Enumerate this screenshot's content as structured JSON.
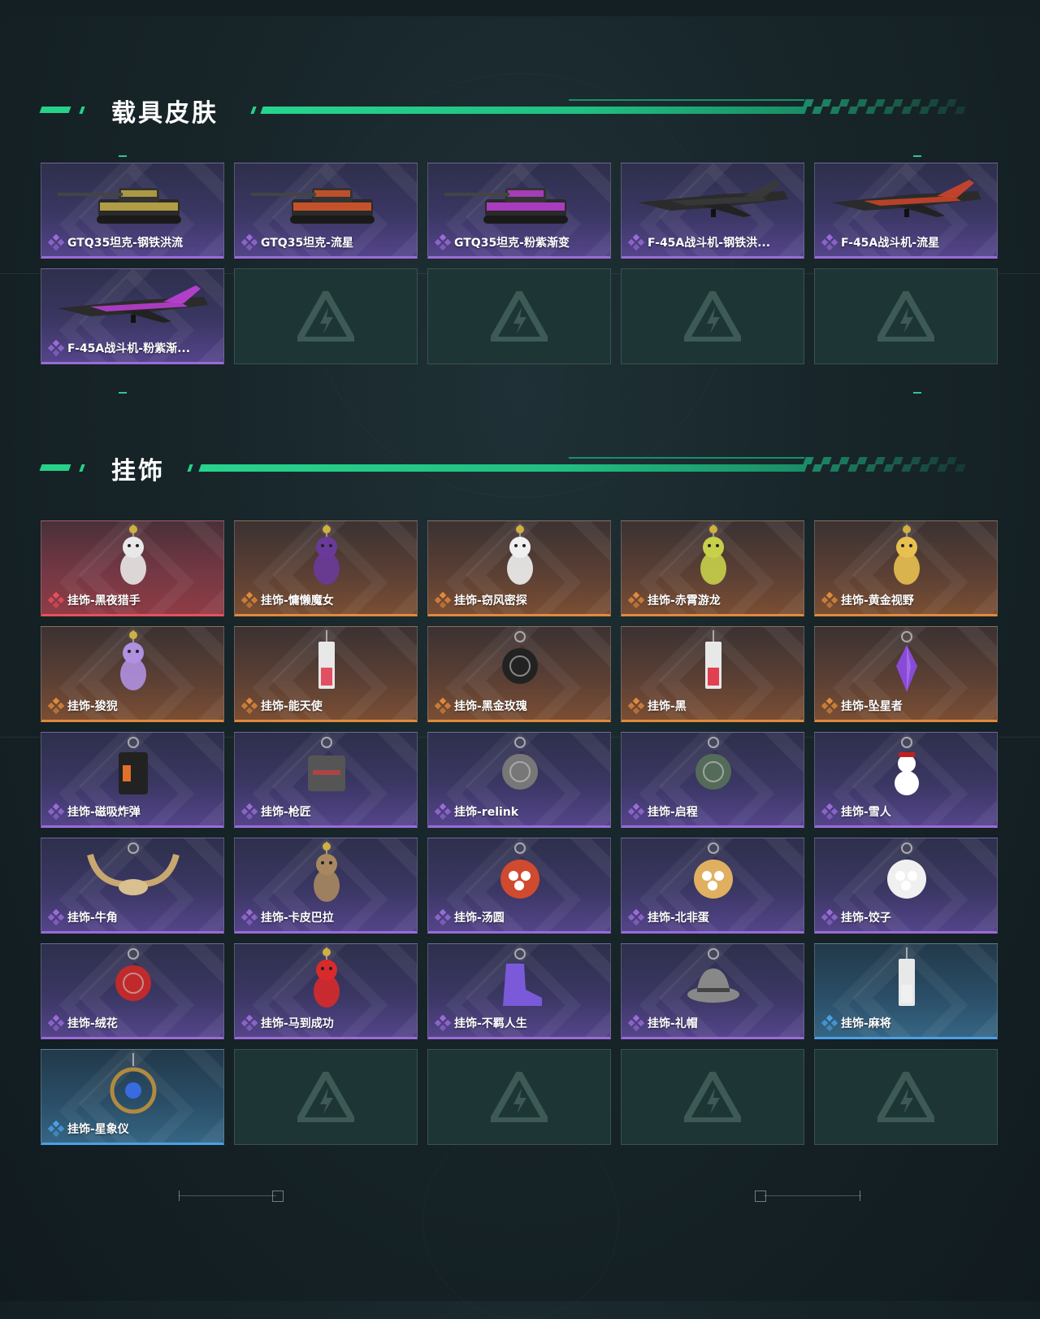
{
  "sections": {
    "vehicles": {
      "title": "载具皮肤",
      "items": [
        {
          "label": "GTQ35坦克-钢铁洪流",
          "rarity": "purple",
          "art": "tank",
          "color": "#c9b24a"
        },
        {
          "label": "GTQ35坦克-流星",
          "rarity": "purple",
          "art": "tank",
          "color": "#e0582a"
        },
        {
          "label": "GTQ35坦克-粉紫渐变",
          "rarity": "purple",
          "art": "tank",
          "color": "#c040d8"
        },
        {
          "label": "F-45A战斗机-钢铁洪...",
          "rarity": "purple",
          "art": "jet",
          "color": "#3a3a3a"
        },
        {
          "label": "F-45A战斗机-流星",
          "rarity": "purple",
          "art": "jet",
          "color": "#d0452a"
        },
        {
          "label": "F-45A战斗机-粉紫渐...",
          "rarity": "purple",
          "art": "jet",
          "color": "#c040d8"
        },
        {
          "label": "",
          "rarity": "empty"
        },
        {
          "label": "",
          "rarity": "empty"
        },
        {
          "label": "",
          "rarity": "empty"
        },
        {
          "label": "",
          "rarity": "empty"
        }
      ]
    },
    "charms": {
      "title": "挂饰",
      "items": [
        {
          "label": "挂饰-黑夜猎手",
          "rarity": "red",
          "art": "figure",
          "color": "#e8e8e8"
        },
        {
          "label": "挂饰-慵懒魔女",
          "rarity": "orange",
          "art": "figure",
          "color": "#6a3a9a"
        },
        {
          "label": "挂饰-窃风密探",
          "rarity": "orange",
          "art": "figure",
          "color": "#f0f0f0"
        },
        {
          "label": "挂饰-赤霄游龙",
          "rarity": "orange",
          "art": "figure",
          "color": "#c8d04a"
        },
        {
          "label": "挂饰-黄金视野",
          "rarity": "orange",
          "art": "figure",
          "color": "#e8c050"
        },
        {
          "label": "挂饰-狻猊",
          "rarity": "orange",
          "art": "figure",
          "color": "#b090e0"
        },
        {
          "label": "挂饰-能天使",
          "rarity": "orange",
          "art": "tag",
          "color": "#e05060"
        },
        {
          "label": "挂饰-黑金玫瑰",
          "rarity": "orange",
          "art": "round",
          "color": "#222222"
        },
        {
          "label": "挂饰-黑",
          "rarity": "orange",
          "art": "tag",
          "color": "#e04050"
        },
        {
          "label": "挂饰-坠星者",
          "rarity": "orange",
          "art": "gem",
          "color": "#8a4ad8"
        },
        {
          "label": "挂饰-磁吸炸弹",
          "rarity": "purple",
          "art": "bomb",
          "color": "#222222"
        },
        {
          "label": "挂饰-枪匠",
          "rarity": "purple",
          "art": "box",
          "color": "#555555"
        },
        {
          "label": "挂饰-relink",
          "rarity": "purple",
          "art": "round",
          "color": "#777777"
        },
        {
          "label": "挂饰-启程",
          "rarity": "purple",
          "art": "round",
          "color": "#556b5a"
        },
        {
          "label": "挂饰-雪人",
          "rarity": "purple",
          "art": "snowman",
          "color": "#ffffff"
        },
        {
          "label": "挂饰-牛角",
          "rarity": "purple",
          "art": "horns",
          "color": "#c8a870"
        },
        {
          "label": "挂饰-卡皮巴拉",
          "rarity": "purple",
          "art": "figure",
          "color": "#a88860"
        },
        {
          "label": "挂饰-汤圆",
          "rarity": "purple",
          "art": "bowl",
          "color": "#d04a30"
        },
        {
          "label": "挂饰-北非蛋",
          "rarity": "purple",
          "art": "bowl",
          "color": "#e0b060"
        },
        {
          "label": "挂饰-饺子",
          "rarity": "purple",
          "art": "bowl",
          "color": "#f0f0f0"
        },
        {
          "label": "挂饰-绒花",
          "rarity": "purple",
          "art": "round",
          "color": "#c02a2a"
        },
        {
          "label": "挂饰-马到成功",
          "rarity": "purple",
          "art": "figure",
          "color": "#d82a2a"
        },
        {
          "label": "挂饰-不羁人生",
          "rarity": "purple",
          "art": "shoe",
          "color": "#7a5ad8"
        },
        {
          "label": "挂饰-礼帽",
          "rarity": "purple",
          "art": "hat",
          "color": "#888888"
        },
        {
          "label": "挂饰-麻将",
          "rarity": "blue",
          "art": "tag",
          "color": "#f0f0f0"
        },
        {
          "label": "挂饰-星象仪",
          "rarity": "blue",
          "art": "ring",
          "color": "#b08a40"
        },
        {
          "label": "",
          "rarity": "empty"
        },
        {
          "label": "",
          "rarity": "empty"
        },
        {
          "label": "",
          "rarity": "empty"
        },
        {
          "label": "",
          "rarity": "empty"
        }
      ]
    }
  },
  "colors": {
    "accent": "#26d18a",
    "rarity_purple": "#9b6bd8",
    "rarity_orange": "#e08a3c",
    "rarity_red": "#e8505a",
    "rarity_blue": "#4aa0e6"
  },
  "icons": {
    "rarity": "diamond-cluster-icon",
    "empty_slot": "placeholder-logo-icon"
  }
}
